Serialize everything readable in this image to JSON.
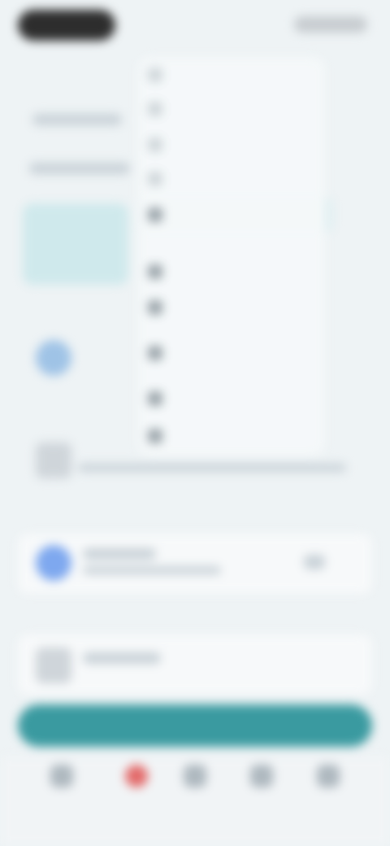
{
  "colors": {
    "accent": "#3a9aa0",
    "background": "#eef3f5",
    "alert": "#e36a6a"
  },
  "menu": {
    "items": [
      {
        "label": "",
        "icon": "menu-item-icon"
      },
      {
        "label": "",
        "icon": "menu-item-icon"
      },
      {
        "label": "",
        "icon": "menu-item-icon"
      },
      {
        "label": "",
        "icon": "menu-item-icon"
      },
      {
        "label": "",
        "icon": "menu-item-icon"
      },
      {
        "label": "",
        "icon": "menu-item-icon"
      },
      {
        "label": "",
        "icon": "menu-item-icon"
      },
      {
        "label": "",
        "icon": "menu-item-icon"
      },
      {
        "label": "",
        "icon": "menu-item-icon"
      },
      {
        "label": "",
        "icon": "menu-item-icon"
      }
    ]
  },
  "primary_button": {
    "label": ""
  },
  "bottom_nav": {
    "items": [
      {
        "label": "",
        "icon": "home-icon"
      },
      {
        "label": "",
        "icon": "notification-icon"
      },
      {
        "label": "",
        "icon": "user-icon"
      },
      {
        "label": "",
        "icon": "search-icon"
      },
      {
        "label": "",
        "icon": "profile-icon"
      }
    ]
  }
}
